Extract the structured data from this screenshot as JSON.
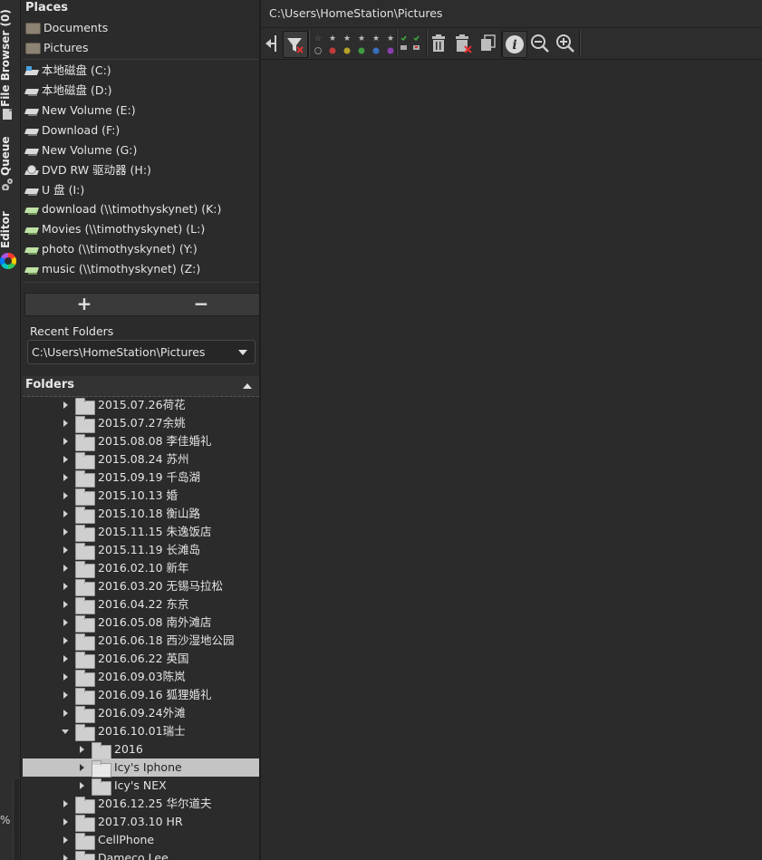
{
  "vertical_tabs": [
    {
      "label": "File Browser (0)"
    },
    {
      "label": "Queue"
    },
    {
      "label": "Editor"
    }
  ],
  "zoom_percent_symbol": "%",
  "places": {
    "title": "Places",
    "favorites": [
      {
        "label": "Documents",
        "icon": "folder-camera-icon"
      },
      {
        "label": "Pictures",
        "icon": "folder-camera-icon"
      }
    ],
    "drives": [
      {
        "label": "本地磁盘 (C:)",
        "icon": "system-drive-icon"
      },
      {
        "label": "本地磁盘 (D:)",
        "icon": "drive-icon"
      },
      {
        "label": "New Volume (E:)",
        "icon": "drive-icon"
      },
      {
        "label": "Download (F:)",
        "icon": "drive-icon"
      },
      {
        "label": "New Volume (G:)",
        "icon": "drive-icon"
      },
      {
        "label": "DVD RW 驱动器 (H:)",
        "icon": "dvd-drive-icon"
      },
      {
        "label": "U 盘 (I:)",
        "icon": "drive-icon"
      },
      {
        "label": "download (\\\\timothyskynet) (K:)",
        "icon": "network-drive-icon"
      },
      {
        "label": "Movies (\\\\timothyskynet) (L:)",
        "icon": "network-drive-icon"
      },
      {
        "label": "photo (\\\\timothyskynet) (Y:)",
        "icon": "network-drive-icon"
      },
      {
        "label": "music (\\\\timothyskynet) (Z:)",
        "icon": "network-drive-icon"
      }
    ],
    "add_label": "+",
    "remove_label": "−"
  },
  "recent": {
    "label": "Recent Folders",
    "value": "C:\\Users\\HomeStation\\Pictures"
  },
  "folders": {
    "title": "Folders",
    "items": [
      {
        "label": "2015.07.26荷花",
        "level": 0,
        "expanded": false,
        "selected": false
      },
      {
        "label": "2015.07.27余姚",
        "level": 0,
        "expanded": false,
        "selected": false
      },
      {
        "label": "2015.08.08 李佳婚礼",
        "level": 0,
        "expanded": false,
        "selected": false
      },
      {
        "label": "2015.08.24 苏州",
        "level": 0,
        "expanded": false,
        "selected": false
      },
      {
        "label": "2015.09.19 千岛湖",
        "level": 0,
        "expanded": false,
        "selected": false
      },
      {
        "label": "2015.10.13 婚",
        "level": 0,
        "expanded": false,
        "selected": false
      },
      {
        "label": "2015.10.18 衡山路",
        "level": 0,
        "expanded": false,
        "selected": false
      },
      {
        "label": "2015.11.15 朱逸饭店",
        "level": 0,
        "expanded": false,
        "selected": false
      },
      {
        "label": "2015.11.19 长滩岛",
        "level": 0,
        "expanded": false,
        "selected": false
      },
      {
        "label": "2016.02.10 新年",
        "level": 0,
        "expanded": false,
        "selected": false
      },
      {
        "label": "2016.03.20 无锡马拉松",
        "level": 0,
        "expanded": false,
        "selected": false
      },
      {
        "label": "2016.04.22 东京",
        "level": 0,
        "expanded": false,
        "selected": false
      },
      {
        "label": "2016.05.08 南外滩店",
        "level": 0,
        "expanded": false,
        "selected": false
      },
      {
        "label": "2016.06.18 西沙湿地公园",
        "level": 0,
        "expanded": false,
        "selected": false
      },
      {
        "label": "2016.06.22 英国",
        "level": 0,
        "expanded": false,
        "selected": false
      },
      {
        "label": "2016.09.03陈岚",
        "level": 0,
        "expanded": false,
        "selected": false
      },
      {
        "label": "2016.09.16 狐狸婚礼",
        "level": 0,
        "expanded": false,
        "selected": false
      },
      {
        "label": "2016.09.24外滩",
        "level": 0,
        "expanded": false,
        "selected": false
      },
      {
        "label": "2016.10.01瑞士",
        "level": 0,
        "expanded": true,
        "selected": false
      },
      {
        "label": "2016",
        "level": 1,
        "expanded": false,
        "selected": false
      },
      {
        "label": "Icy's Iphone",
        "level": 1,
        "expanded": false,
        "selected": true
      },
      {
        "label": "Icy's NEX",
        "level": 1,
        "expanded": false,
        "selected": false
      },
      {
        "label": "2016.12.25 华尔道夫",
        "level": 0,
        "expanded": false,
        "selected": false
      },
      {
        "label": "2017.03.10 HR",
        "level": 0,
        "expanded": false,
        "selected": false
      },
      {
        "label": "CellPhone",
        "level": 0,
        "expanded": false,
        "selected": false
      },
      {
        "label": "Dameco Lee",
        "level": 0,
        "expanded": false,
        "selected": false
      }
    ]
  },
  "path": "C:\\Users\\HomeStation\\Pictures",
  "toolbar": {
    "buttons": [
      {
        "name": "collapse-panel-icon",
        "pressed": false
      },
      {
        "name": "filter-icon",
        "pressed": true
      },
      {
        "name": "star-rating-filter-icon",
        "pressed": false
      },
      {
        "name": "color-label-filter-icon",
        "pressed": false
      },
      {
        "name": "edited-filter-icon",
        "pressed": false
      },
      {
        "name": "trash-icon",
        "pressed": false
      },
      {
        "name": "delete-icon",
        "pressed": false
      },
      {
        "name": "copy-icon",
        "pressed": false
      },
      {
        "name": "info-icon",
        "pressed": true
      },
      {
        "name": "zoom-out-icon",
        "pressed": false
      },
      {
        "name": "zoom-in-icon",
        "pressed": false
      }
    ],
    "label_colors": [
      "#c03a3a",
      "#b5a22a",
      "#3f9a3f",
      "#3a6fc0",
      "#8a3fb0"
    ]
  }
}
